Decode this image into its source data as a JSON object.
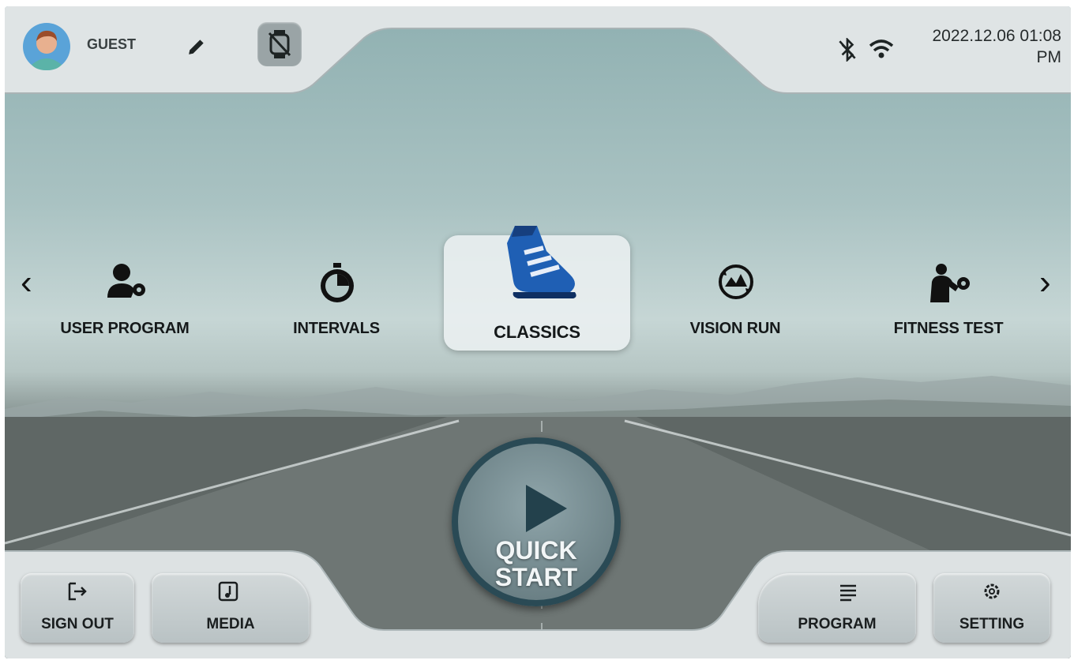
{
  "header": {
    "user_name": "GUEST",
    "datetime_line1": "2022.12.06 01:08",
    "datetime_line2": "PM"
  },
  "icons": {
    "avatar": "avatar-icon",
    "edit": "pencil-icon",
    "watch": "watch-disconnected-icon",
    "bluetooth": "bluetooth-off-icon",
    "wifi": "wifi-icon"
  },
  "programs": {
    "prev": "‹",
    "next": "›",
    "items": [
      {
        "label": "USER PROGRAM",
        "icon": "user-settings-icon"
      },
      {
        "label": "INTERVALS",
        "icon": "stopwatch-icon"
      },
      {
        "label": "CLASSICS",
        "icon": "running-shoe-icon",
        "selected": true
      },
      {
        "label": "VISION RUN",
        "icon": "vision-run-icon"
      },
      {
        "label": "FITNESS TEST",
        "icon": "fitness-test-icon"
      }
    ]
  },
  "quick_start": {
    "line1": "QUICK",
    "line2": "START"
  },
  "footer": {
    "sign_out": "SIGN OUT",
    "media": "MEDIA",
    "program": "PROGRAM",
    "setting": "SETTING"
  },
  "colors": {
    "accent_blue": "#1f5fb4",
    "panel": "#d6dcdd",
    "quick_start_ring": "#2a4a55"
  }
}
